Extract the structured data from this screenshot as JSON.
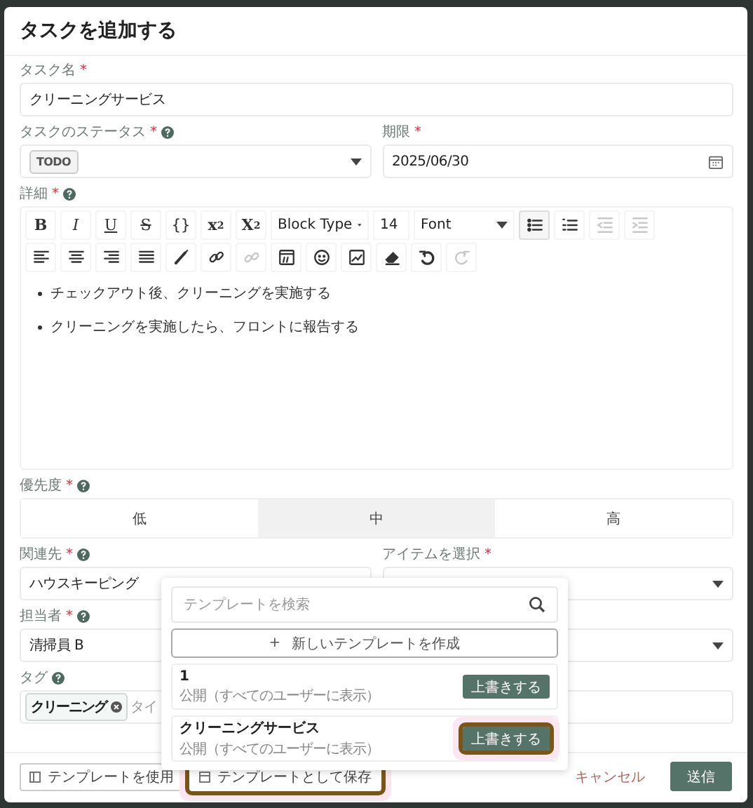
{
  "dialog": {
    "title": "タスクを追加する"
  },
  "task_name": {
    "label": "タスク名",
    "required_mark": "*",
    "value": "クリーニングサービス"
  },
  "status": {
    "label": "タスクのステータス",
    "required_mark": "*",
    "help": true,
    "value": "TODO"
  },
  "due_date": {
    "label": "期限",
    "required_mark": "*",
    "value": "2025/06/30"
  },
  "details": {
    "label": "詳細",
    "required_mark": "*",
    "help": true,
    "toolbar_row_1": [
      {
        "kind": "text",
        "label": "B",
        "selected": false,
        "disabled": false
      },
      {
        "kind": "text",
        "label": "I",
        "selected": false,
        "disabled": false
      },
      {
        "kind": "text",
        "label": "U",
        "selected": false,
        "disabled": false
      },
      {
        "kind": "text",
        "label": "S",
        "selected": false,
        "disabled": false
      },
      {
        "kind": "text",
        "label": "{}",
        "selected": false,
        "disabled": false
      },
      {
        "kind": "superscript",
        "label": "x",
        "mark": "2",
        "selected": false,
        "disabled": false
      },
      {
        "kind": "subscript",
        "label": "X",
        "mark": "2",
        "selected": false,
        "disabled": false
      },
      {
        "kind": "select",
        "label": "Block Type"
      },
      {
        "kind": "select",
        "label": "14"
      },
      {
        "kind": "select",
        "label": "Font"
      },
      {
        "kind": "icon",
        "selected": true,
        "disabled": false
      },
      {
        "kind": "icon",
        "selected": false,
        "disabled": false
      },
      {
        "kind": "icon",
        "selected": false,
        "disabled": true
      },
      {
        "kind": "icon",
        "selected": false,
        "disabled": true
      }
    ],
    "toolbar_row_2": [
      {
        "kind": "icon",
        "selected": false,
        "disabled": false
      },
      {
        "kind": "icon",
        "selected": false,
        "disabled": false
      },
      {
        "kind": "icon",
        "selected": false,
        "disabled": false
      },
      {
        "kind": "icon",
        "selected": false,
        "disabled": false
      },
      {
        "kind": "icon",
        "selected": false,
        "disabled": false
      },
      {
        "kind": "icon",
        "selected": false,
        "disabled": false
      },
      {
        "kind": "icon",
        "selected": false,
        "disabled": true
      },
      {
        "kind": "icon",
        "selected": false,
        "disabled": false
      },
      {
        "kind": "icon",
        "selected": false,
        "disabled": false
      },
      {
        "kind": "icon",
        "selected": false,
        "disabled": false
      },
      {
        "kind": "icon",
        "selected": false,
        "disabled": false
      },
      {
        "kind": "icon",
        "selected": false,
        "disabled": false
      },
      {
        "kind": "icon",
        "selected": false,
        "disabled": true
      }
    ],
    "bullets": [
      "チェックアウト後、クリーニングを実施する",
      "クリーニングを実施したら、フロントに報告する"
    ]
  },
  "priority": {
    "label": "優先度",
    "required_mark": "*",
    "help": true,
    "options": [
      {
        "label": "低",
        "selected": false
      },
      {
        "label": "中",
        "selected": true
      },
      {
        "label": "高",
        "selected": false
      }
    ]
  },
  "related": {
    "label": "関連先",
    "required_mark": "*",
    "help": true,
    "value": "ハウスキーピング"
  },
  "item": {
    "label": "アイテムを選択",
    "required_mark": "*"
  },
  "assignee": {
    "label": "担当者",
    "required_mark": "*",
    "help": true,
    "value": "清掃員 B"
  },
  "tags": {
    "label": "タグ",
    "help": true,
    "chips": [
      "クリーニング"
    ],
    "placeholder": "タイ"
  },
  "template_menu": {
    "search_placeholder": "テンプレートを検索",
    "create_icon": "+",
    "create_label": "新しいテンプレートを作成",
    "templates": [
      {
        "name": "1",
        "visibility": "公開（すべてのユーザーに表示）",
        "button": "上書きする",
        "highlighted": false
      },
      {
        "name": "クリーニングサービス",
        "visibility": "公開（すべてのユーザーに表示）",
        "button": "上書きする",
        "highlighted": true
      }
    ]
  },
  "footer": {
    "use_template": {
      "label": "テンプレートを使用",
      "highlighted": false
    },
    "save_template": {
      "label": "テンプレートとして保存",
      "highlighted": true
    },
    "cancel": "キャンセル",
    "submit": "送信"
  }
}
